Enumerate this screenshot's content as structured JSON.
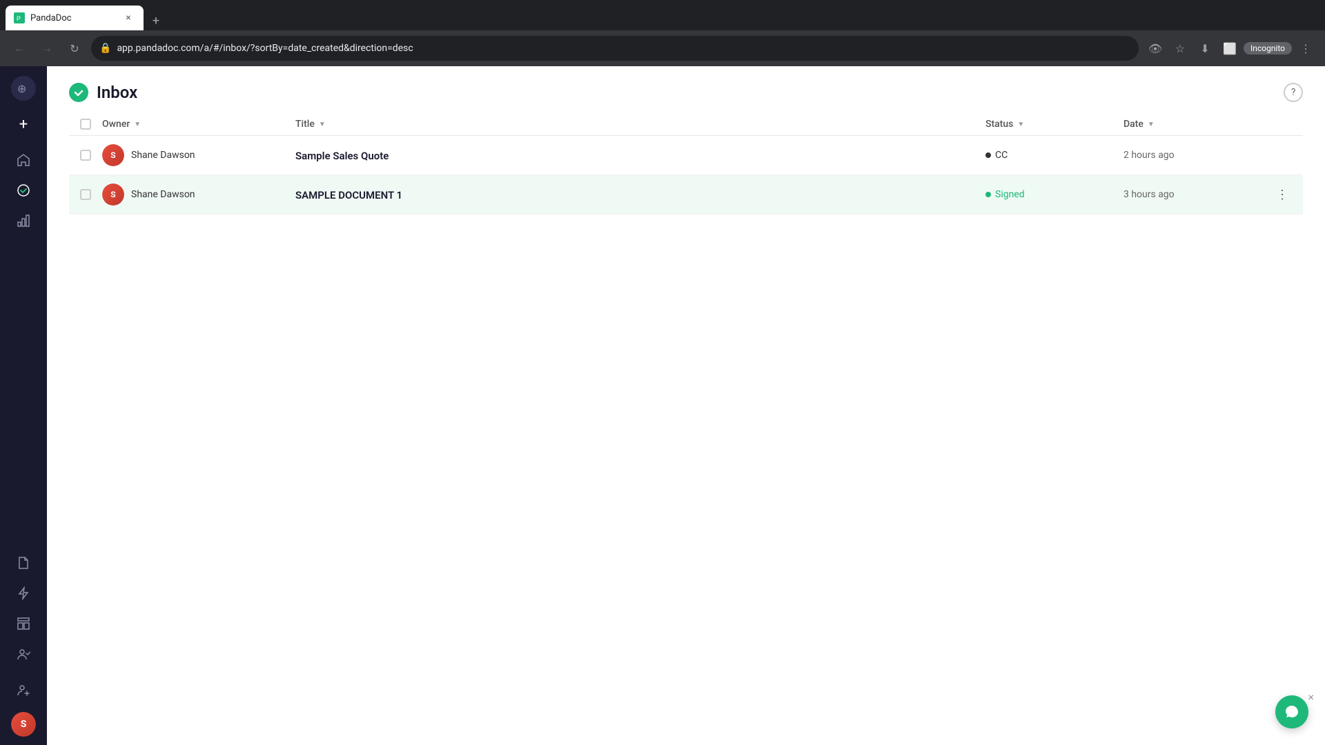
{
  "browser": {
    "tab": {
      "title": "PandaDoc",
      "close_label": "×"
    },
    "new_tab_label": "+",
    "url": "app.pandadoc.com/a/#/inbox/?sortBy=date_created&direction=desc",
    "nav": {
      "back_label": "←",
      "forward_label": "→",
      "refresh_label": "↻",
      "incognito_label": "Incognito"
    }
  },
  "sidebar": {
    "add_label": "+",
    "icons": [
      {
        "name": "home",
        "symbol": "⌂"
      },
      {
        "name": "check",
        "symbol": "✓"
      },
      {
        "name": "chart",
        "symbol": "⊞"
      },
      {
        "name": "document",
        "symbol": "📄"
      },
      {
        "name": "lightning",
        "symbol": "⚡"
      },
      {
        "name": "template",
        "symbol": "⊟"
      },
      {
        "name": "contacts",
        "symbol": "👥"
      }
    ],
    "add_user_label": "👤+"
  },
  "page": {
    "title": "Inbox",
    "help_label": "?"
  },
  "table": {
    "columns": {
      "owner": "Owner",
      "title": "Title",
      "status": "Status",
      "date": "Date"
    },
    "rows": [
      {
        "id": 1,
        "owner": "Shane Dawson",
        "title": "Sample Sales Quote",
        "status": "CC",
        "status_type": "cc",
        "date": "2 hours ago",
        "highlighted": false
      },
      {
        "id": 2,
        "owner": "Shane Dawson",
        "title": "SAMPLE DOCUMENT 1",
        "status": "Signed",
        "status_type": "signed",
        "date": "3 hours ago",
        "highlighted": true
      }
    ]
  },
  "chat": {
    "close_label": "×",
    "open_label": "💬"
  }
}
